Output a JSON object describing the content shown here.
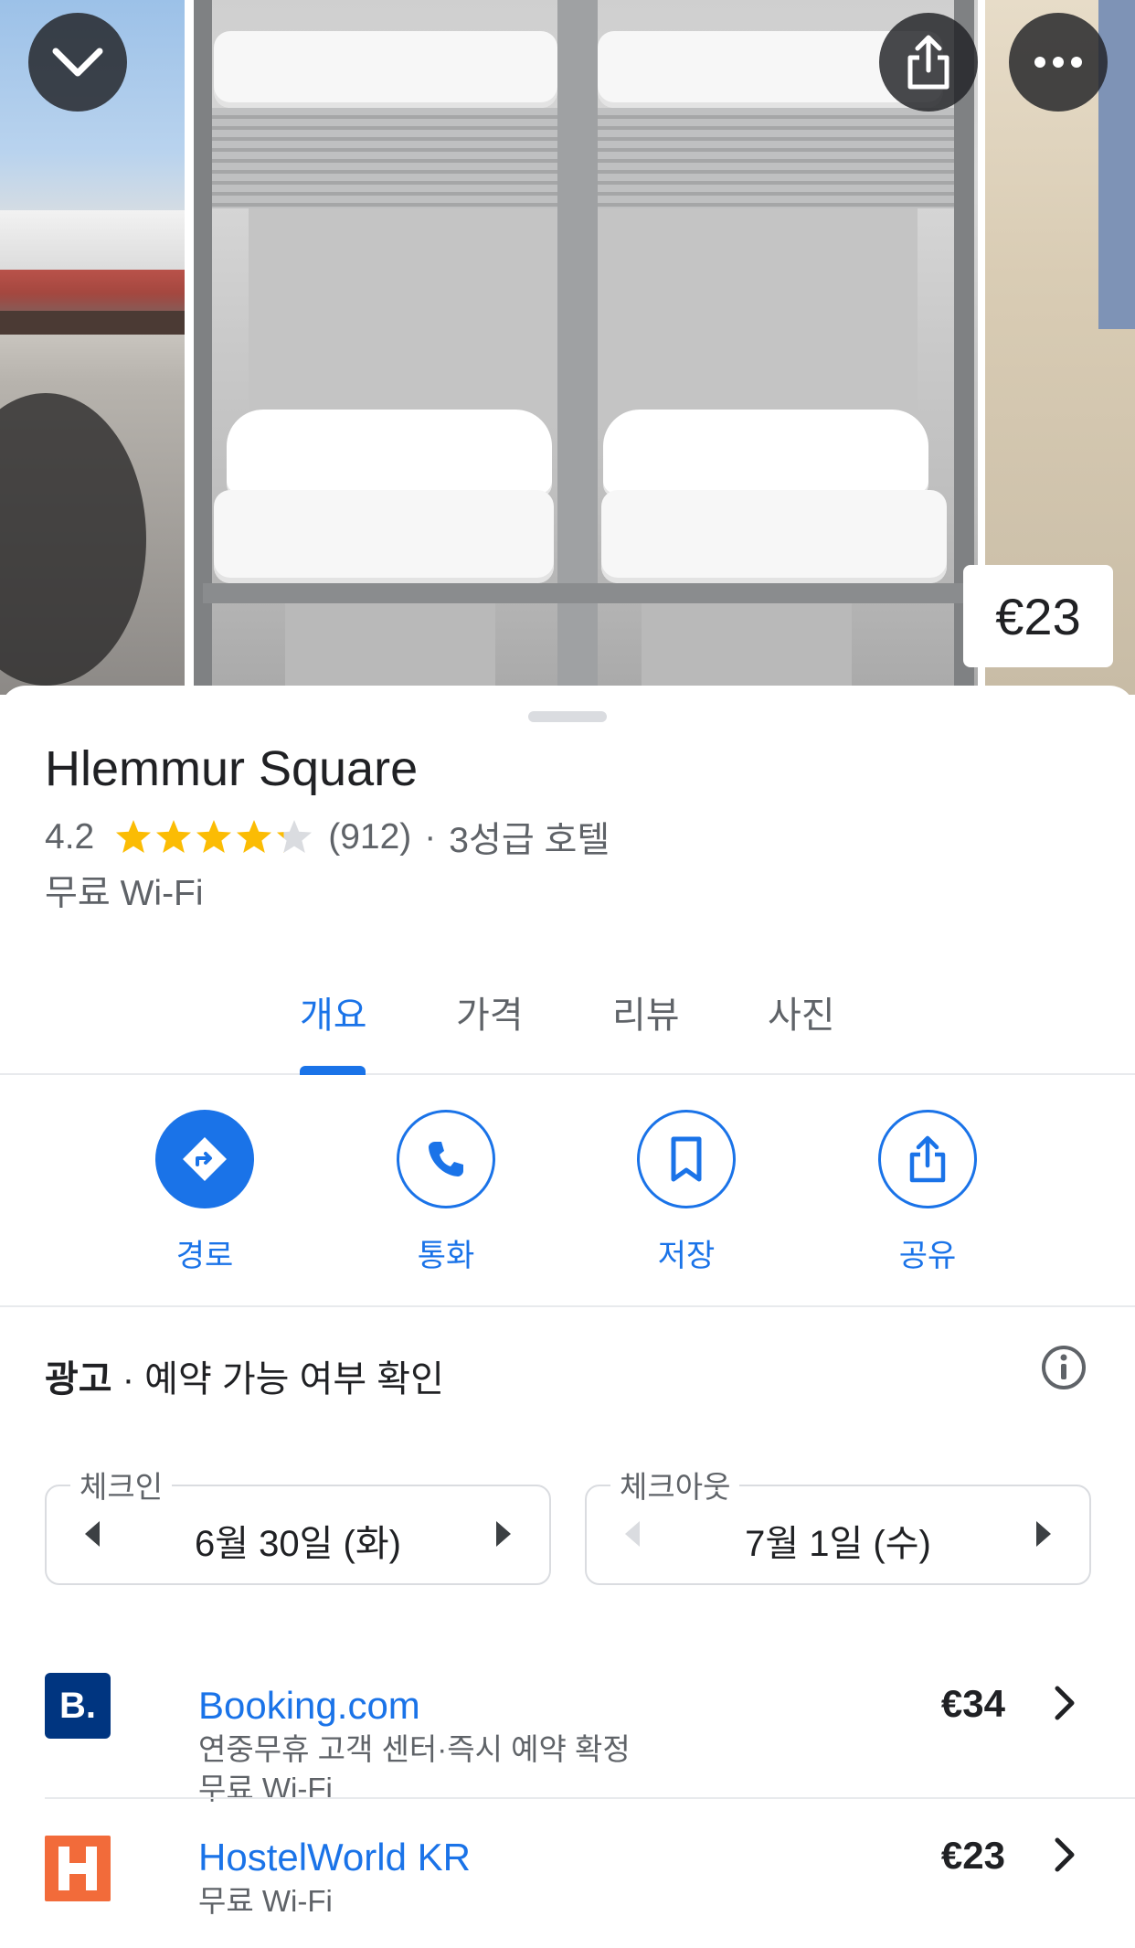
{
  "hero": {
    "price_tag": "€23",
    "collapse_icon": "chevron-down-icon",
    "share_icon": "share-icon",
    "more_icon": "more-horizontal-icon"
  },
  "place": {
    "name": "Hlemmur Square",
    "rating": "4.2",
    "rating_value": 4.2,
    "review_count": "(912)",
    "separator": "·",
    "category": "3성급 호텔",
    "amenity": "무료 Wi-Fi"
  },
  "tabs": [
    {
      "label": "개요",
      "active": true
    },
    {
      "label": "가격",
      "active": false
    },
    {
      "label": "리뷰",
      "active": false
    },
    {
      "label": "사진",
      "active": false
    }
  ],
  "actions": [
    {
      "label": "경로",
      "icon": "directions-icon"
    },
    {
      "label": "통화",
      "icon": "phone-icon"
    },
    {
      "label": "저장",
      "icon": "bookmark-icon"
    },
    {
      "label": "공유",
      "icon": "share-icon"
    }
  ],
  "booking": {
    "ad_label": "광고",
    "heading": " · 예약 가능 여부 확인",
    "checkin": {
      "label": "체크인",
      "value": "6월 30일 (화)"
    },
    "checkout": {
      "label": "체크아웃",
      "value": "7월 1일 (수)"
    }
  },
  "providers": [
    {
      "name": "Booking.com",
      "price": "€34",
      "line1": "연중무휴 고객 센터·즉시 예약 확정",
      "line2": "무료 Wi-Fi",
      "logo_text": "B.",
      "logo_color": "#003580"
    },
    {
      "name": "HostelWorld KR",
      "price": "€23",
      "line1": "무료 Wi-Fi",
      "logo_color": "#f26b3a"
    }
  ],
  "colors": {
    "accent": "#1a73e8",
    "star": "#fbbc04",
    "star_empty": "#dadce0"
  }
}
